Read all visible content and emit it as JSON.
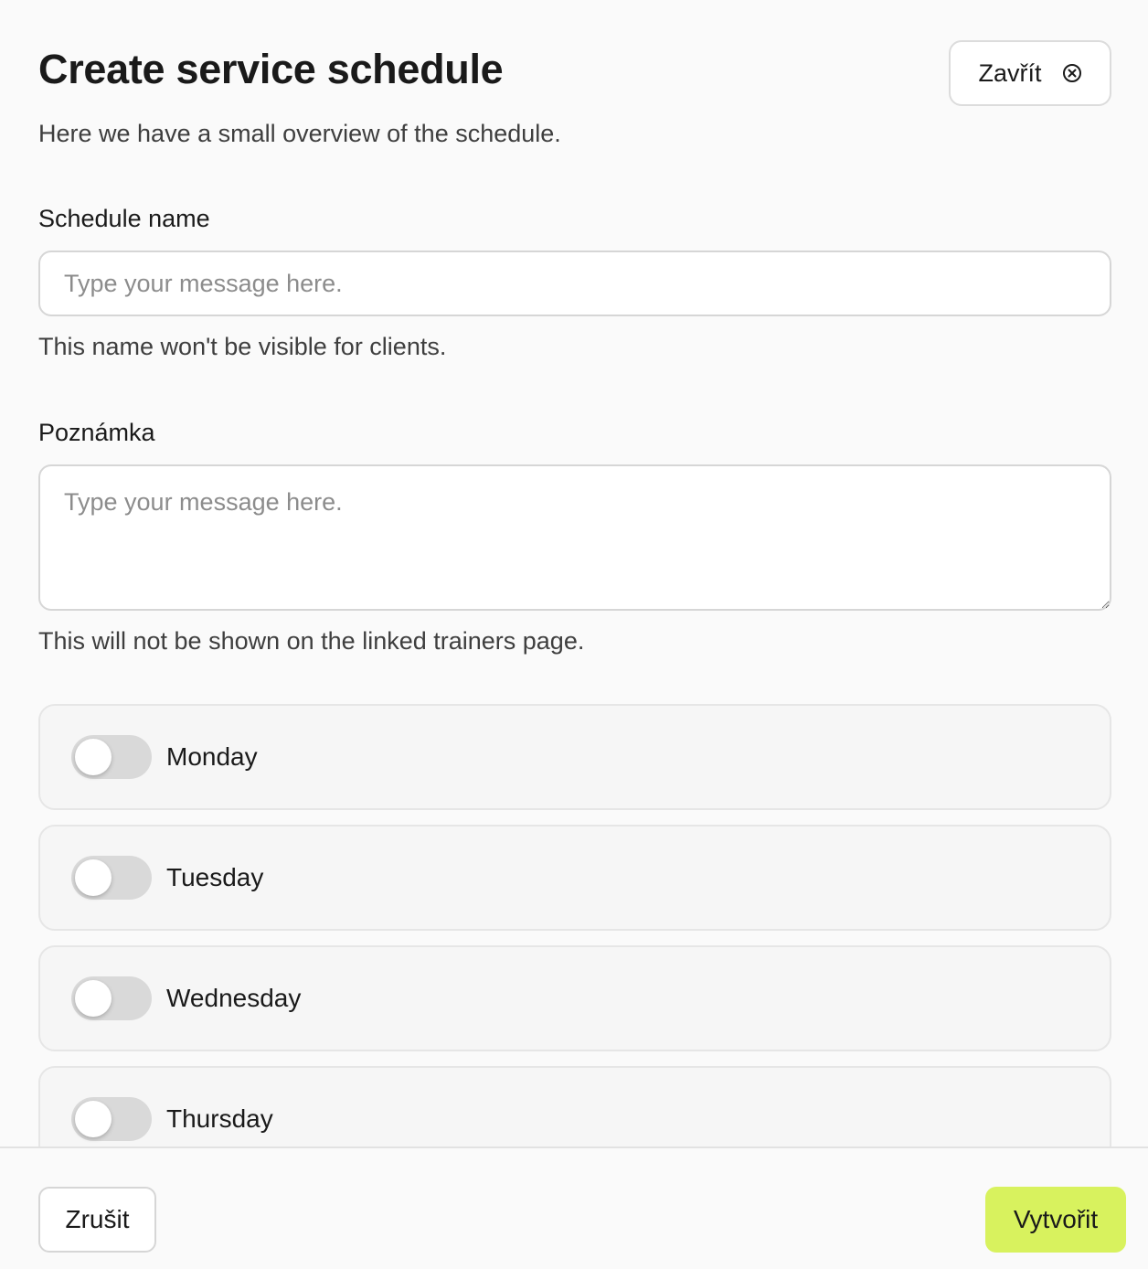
{
  "header": {
    "title": "Create service schedule",
    "close_label": "Zavřít",
    "close_icon": "circle-x-icon"
  },
  "subtitle": "Here we have a small overview of the schedule.",
  "schedule_name": {
    "label": "Schedule name",
    "placeholder": "Type your message here.",
    "value": "",
    "helper": "This name won't be visible for clients."
  },
  "note": {
    "label": "Poznámka",
    "placeholder": "Type your message here.",
    "value": "",
    "helper": "This will not be shown on the linked trainers page."
  },
  "days": [
    {
      "label": "Monday",
      "enabled": false
    },
    {
      "label": "Tuesday",
      "enabled": false
    },
    {
      "label": "Wednesday",
      "enabled": false
    },
    {
      "label": "Thursday",
      "enabled": false
    }
  ],
  "footer": {
    "cancel_label": "Zrušit",
    "create_label": "Vytvořit"
  },
  "colors": {
    "accent": "#d8f25e",
    "toggle_off": "#d9d9d9",
    "card_bg": "#f6f6f6"
  }
}
